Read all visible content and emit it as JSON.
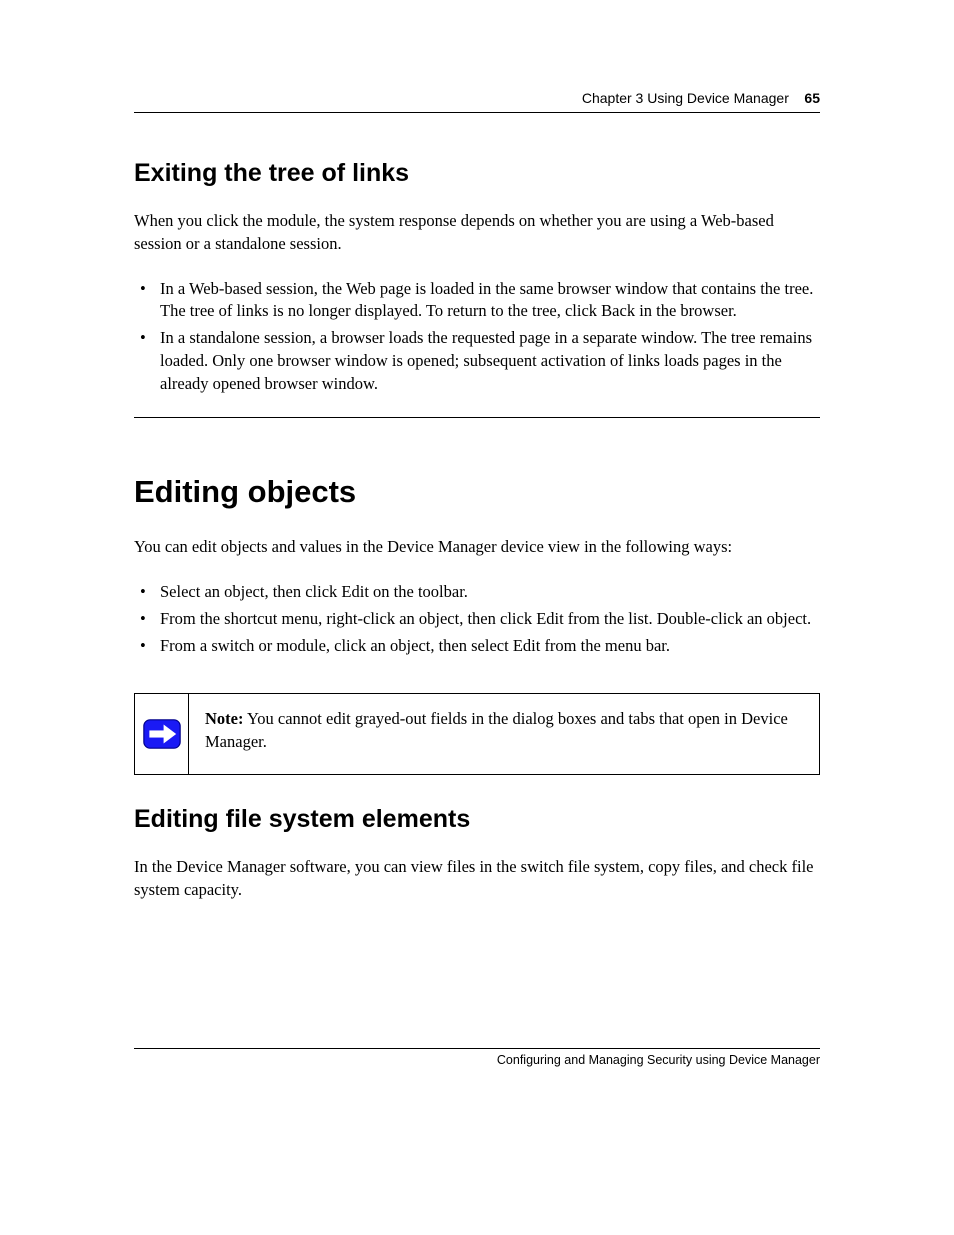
{
  "header": {
    "chapter": "Chapter 3",
    "title": "Using Device Manager",
    "page": "65"
  },
  "sec1": {
    "heading": "Exiting the tree of links",
    "p1": "When you click the module, the system response depends on whether you are using a Web-based session or a standalone session.",
    "bullets": [
      "In a Web-based session, the Web page is loaded in the same browser window that contains the tree. The tree of links is no longer displayed. To return to the tree, click Back in the browser.",
      "In a standalone session, a browser loads the requested page in a separate window. The tree remains loaded. Only one browser window is opened; subsequent activation of links loads pages in the already opened browser window."
    ]
  },
  "sec2": {
    "heading": "Editing objects",
    "p1": "You can edit objects and values in the Device Manager device view in the following ways:",
    "bullets": [
      "Select an object, then click Edit on the toolbar.",
      "From the shortcut menu, right-click an object, then click Edit from the list. Double-click an object.",
      "From a switch or module, click an object, then select Edit from the menu bar."
    ],
    "note_label": "Note:",
    "note_text": " You cannot edit grayed-out fields in the dialog boxes and tabs that open in Device Manager."
  },
  "sec3": {
    "heading": "Editing file system elements",
    "p1": "In the Device Manager software, you can view files in the switch file system, copy files, and check file system capacity."
  },
  "footer": {
    "text": "Configuring and Managing Security using Device Manager"
  }
}
